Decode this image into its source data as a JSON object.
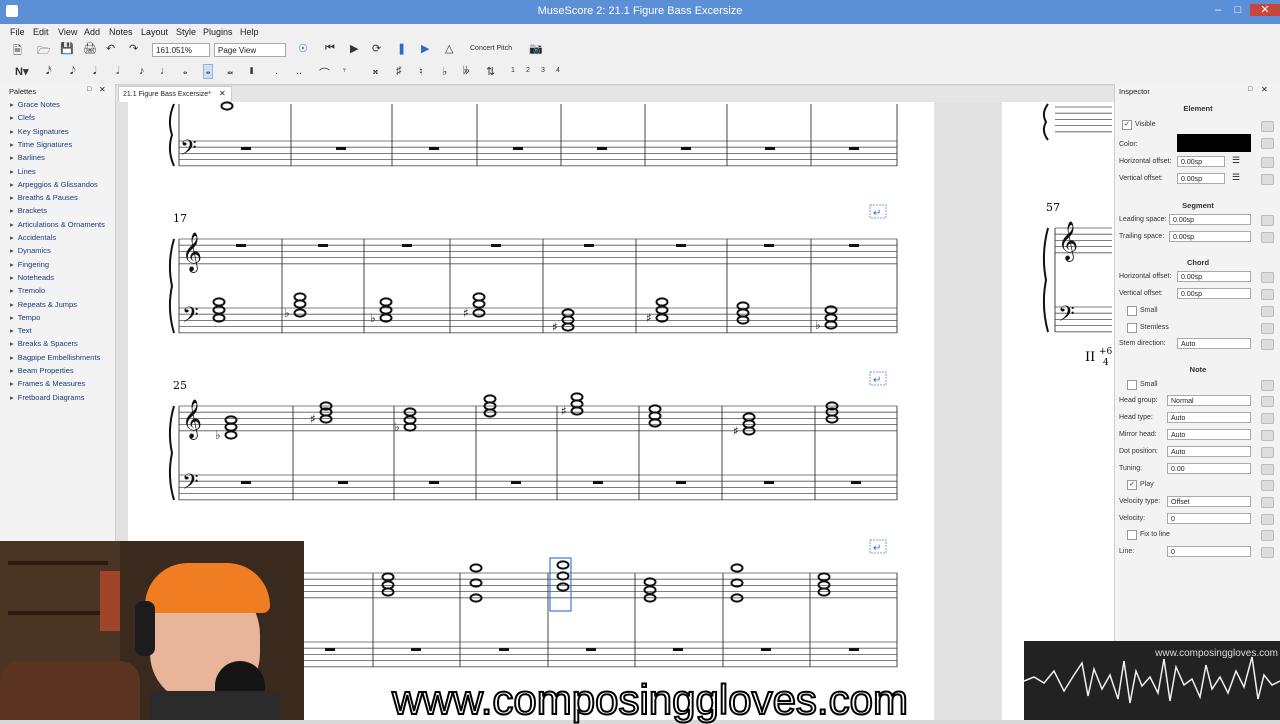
{
  "window": {
    "title": "MuseScore 2: 21.1 Figure Bass Excersize"
  },
  "menu": [
    "File",
    "Edit",
    "View",
    "Add",
    "Notes",
    "Layout",
    "Style",
    "Plugins",
    "Help"
  ],
  "toolbar": {
    "zoom": "161.051%",
    "view_mode": "Page View",
    "concert_pitch": "Concert Pitch"
  },
  "note_input": {
    "voices": [
      "1",
      "2",
      "3",
      "4"
    ]
  },
  "palettes": {
    "header": "Palettes",
    "items": [
      "Grace Notes",
      "Clefs",
      "Key Signatures",
      "Time Signatures",
      "Barlines",
      "Lines",
      "Arpeggios & Glissandos",
      "Breaths & Pauses",
      "Brackets",
      "Articulations & Ornaments",
      "Accidentals",
      "Dynamics",
      "Fingering",
      "Noteheads",
      "Tremolo",
      "Repeats & Jumps",
      "Tempo",
      "Text",
      "Breaks & Spacers",
      "Bagpipe Embellishments",
      "Beam Properties",
      "Frames & Measures",
      "Fretboard Diagrams"
    ]
  },
  "tab": {
    "label": "21.1 Figure Bass Excersize*"
  },
  "score": {
    "measure_numbers": [
      "17",
      "25",
      "57"
    ],
    "figured_bass": "II",
    "figure_top": "+6",
    "figure_bottom": "4"
  },
  "inspector": {
    "header": "Inspector",
    "element": {
      "title": "Element",
      "visible": "Visible",
      "color_label": "Color:",
      "color": "#000000",
      "h_offset_label": "Horizontal offset:",
      "h_offset": "0.00sp",
      "v_offset_label": "Vertical offset:",
      "v_offset": "0.00sp"
    },
    "segment": {
      "title": "Segment",
      "leading_label": "Leading space:",
      "leading": "0.00sp",
      "trailing_label": "Trailing space:",
      "trailing": "0.00sp"
    },
    "chord": {
      "title": "Chord",
      "h_offset_label": "Horizontal offset:",
      "h_offset": "0.00sp",
      "v_offset_label": "Vertical offset:",
      "v_offset": "0.00sp",
      "small": "Small",
      "stemless": "Stemless",
      "stem_label": "Stem direction:",
      "stem": "Auto"
    },
    "note": {
      "title": "Note",
      "small": "Small",
      "head_group_label": "Head group:",
      "head_group": "Normal",
      "head_type_label": "Head type:",
      "head_type": "Auto",
      "mirror_label": "Mirror head:",
      "mirror": "Auto",
      "dot_label": "Dot position:",
      "dot": "Auto",
      "tuning_label": "Tuning:",
      "tuning": "0.00",
      "play": "Play",
      "velocity_type_label": "Velocity type:",
      "velocity_type": "Offset",
      "velocity_label": "Velocity:",
      "velocity": "0",
      "fix_to_line": "Fix to line",
      "line_label": "Line:",
      "line": "0"
    }
  },
  "overlay": {
    "watermark": "www.composinggloves.com",
    "wave_url": "www.composinggloves.com"
  }
}
